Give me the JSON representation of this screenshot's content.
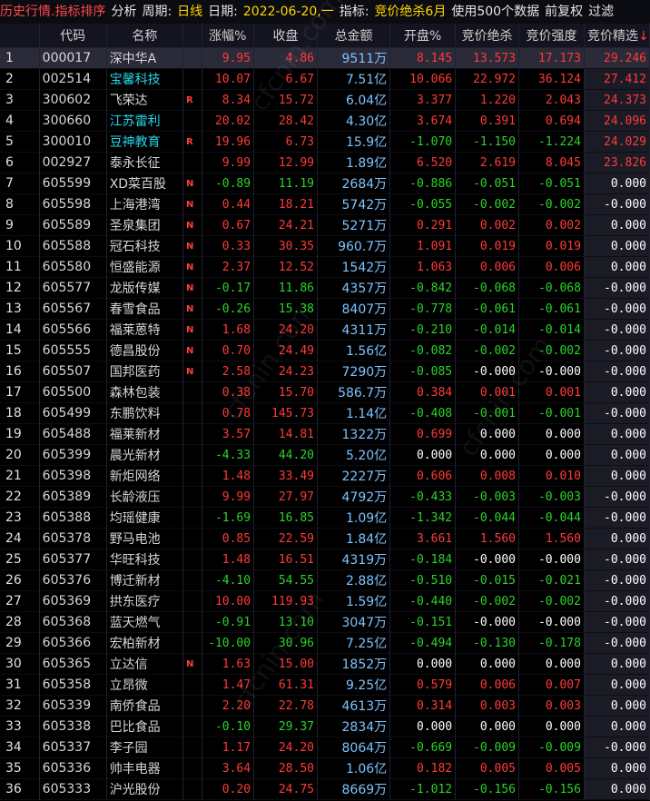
{
  "toolbar": {
    "items": [
      {
        "text": "历史行情.指标排序",
        "style": "t-red"
      },
      {
        "text": "分析",
        "style": "t-white"
      },
      {
        "text": "周期:",
        "style": "t-white"
      },
      {
        "text": "日线",
        "style": "t-yellow"
      },
      {
        "text": "日期:",
        "style": "t-white"
      },
      {
        "text": "2022-06-20,一",
        "style": "t-yellow"
      },
      {
        "text": "指标:",
        "style": "t-white"
      },
      {
        "text": "竞价绝杀6月",
        "style": "t-yellow"
      },
      {
        "text": "使用500个数据",
        "style": "t-white"
      },
      {
        "text": "前复权",
        "style": "t-white"
      },
      {
        "text": "过滤",
        "style": "t-white"
      }
    ]
  },
  "columns": [
    "",
    "代码",
    "名称",
    "",
    "涨幅%",
    "收盘",
    "总金额",
    "开盘%",
    "竞价绝杀",
    "竞价强度",
    "竞价精选"
  ],
  "sort_indicator": "↓",
  "watermark": "cfcnin.com",
  "rows": [
    {
      "i": "1",
      "code": "000017",
      "name": "深中华A",
      "cyan": false,
      "flag": "",
      "pct": "9.95",
      "close": "4.86",
      "amt": "9511万",
      "open": "8.145",
      "jj": "13.573",
      "qd": "17.173",
      "jx": "29.246",
      "sel": true
    },
    {
      "i": "2",
      "code": "002514",
      "name": "宝馨科技",
      "cyan": true,
      "flag": "",
      "pct": "10.07",
      "close": "6.67",
      "amt": "7.51亿",
      "open": "10.066",
      "jj": "22.972",
      "qd": "36.124",
      "jx": "27.412"
    },
    {
      "i": "3",
      "code": "300602",
      "name": "飞荣达",
      "cyan": false,
      "flag": "R",
      "pct": "8.34",
      "close": "15.72",
      "amt": "6.04亿",
      "open": "3.377",
      "jj": "1.220",
      "qd": "2.043",
      "jx": "24.373"
    },
    {
      "i": "4",
      "code": "300660",
      "name": "江苏雷利",
      "cyan": true,
      "flag": "",
      "pct": "20.02",
      "close": "28.42",
      "amt": "4.30亿",
      "open": "3.674",
      "jj": "0.391",
      "qd": "0.694",
      "jx": "24.096"
    },
    {
      "i": "5",
      "code": "300010",
      "name": "豆神教育",
      "cyan": true,
      "flag": "R",
      "pct": "19.96",
      "close": "6.73",
      "amt": "15.9亿",
      "open": "-1.070",
      "jj": "-1.150",
      "qd": "-1.224",
      "jx": "24.029"
    },
    {
      "i": "6",
      "code": "002927",
      "name": "泰永长征",
      "cyan": false,
      "flag": "",
      "pct": "9.99",
      "close": "12.99",
      "amt": "1.89亿",
      "open": "6.520",
      "jj": "2.619",
      "qd": "8.045",
      "jx": "23.826"
    },
    {
      "i": "7",
      "code": "605599",
      "name": "XD菜百股",
      "cyan": false,
      "flag": "N",
      "pct": "-0.89",
      "close": "11.19",
      "amt": "2684万",
      "open": "-0.886",
      "jj": "-0.051",
      "qd": "-0.051",
      "jx": "0.000"
    },
    {
      "i": "8",
      "code": "605598",
      "name": "上海港湾",
      "cyan": false,
      "flag": "N",
      "pct": "0.44",
      "close": "18.21",
      "amt": "5742万",
      "open": "-0.055",
      "jj": "-0.002",
      "qd": "-0.002",
      "jx": "-0.000"
    },
    {
      "i": "9",
      "code": "605589",
      "name": "圣泉集团",
      "cyan": false,
      "flag": "N",
      "pct": "0.67",
      "close": "24.21",
      "amt": "5271万",
      "open": "0.291",
      "jj": "0.002",
      "qd": "0.002",
      "jx": "0.000"
    },
    {
      "i": "10",
      "code": "605588",
      "name": "冠石科技",
      "cyan": false,
      "flag": "N",
      "pct": "0.33",
      "close": "30.35",
      "amt": "960.7万",
      "open": "1.091",
      "jj": "0.019",
      "qd": "0.019",
      "jx": "0.000"
    },
    {
      "i": "11",
      "code": "605580",
      "name": "恒盛能源",
      "cyan": false,
      "flag": "N",
      "pct": "2.37",
      "close": "12.52",
      "amt": "1542万",
      "open": "1.063",
      "jj": "0.006",
      "qd": "0.006",
      "jx": "0.000"
    },
    {
      "i": "12",
      "code": "605577",
      "name": "龙版传媒",
      "cyan": false,
      "flag": "N",
      "pct": "-0.17",
      "close": "11.86",
      "amt": "4357万",
      "open": "-0.842",
      "jj": "-0.068",
      "qd": "-0.068",
      "jx": "-0.000"
    },
    {
      "i": "13",
      "code": "605567",
      "name": "春雪食品",
      "cyan": false,
      "flag": "N",
      "pct": "-0.26",
      "close": "15.38",
      "amt": "8407万",
      "open": "-0.778",
      "jj": "-0.061",
      "qd": "-0.061",
      "jx": "-0.000"
    },
    {
      "i": "14",
      "code": "605566",
      "name": "福莱蒽特",
      "cyan": false,
      "flag": "N",
      "pct": "1.68",
      "close": "24.20",
      "amt": "4311万",
      "open": "-0.210",
      "jj": "-0.014",
      "qd": "-0.014",
      "jx": "-0.000"
    },
    {
      "i": "15",
      "code": "605555",
      "name": "德昌股份",
      "cyan": false,
      "flag": "N",
      "pct": "0.70",
      "close": "24.49",
      "amt": "1.56亿",
      "open": "-0.082",
      "jj": "-0.002",
      "qd": "-0.002",
      "jx": "-0.000"
    },
    {
      "i": "16",
      "code": "605507",
      "name": "国邦医药",
      "cyan": false,
      "flag": "N",
      "pct": "2.58",
      "close": "24.23",
      "amt": "7290万",
      "open": "-0.085",
      "jj": "-0.000",
      "qd": "-0.000",
      "jx": "-0.000"
    },
    {
      "i": "17",
      "code": "605500",
      "name": "森林包装",
      "cyan": false,
      "flag": "",
      "pct": "0.38",
      "close": "15.70",
      "amt": "586.7万",
      "open": "0.384",
      "jj": "0.001",
      "qd": "0.001",
      "jx": "0.000"
    },
    {
      "i": "18",
      "code": "605499",
      "name": "东鹏饮料",
      "cyan": false,
      "flag": "",
      "pct": "0.78",
      "close": "145.73",
      "amt": "1.14亿",
      "open": "-0.408",
      "jj": "-0.001",
      "qd": "-0.001",
      "jx": "-0.000"
    },
    {
      "i": "19",
      "code": "605488",
      "name": "福莱新材",
      "cyan": false,
      "flag": "",
      "pct": "3.57",
      "close": "14.81",
      "amt": "1322万",
      "open": "0.699",
      "jj": "0.000",
      "qd": "0.000",
      "jx": "0.000"
    },
    {
      "i": "20",
      "code": "605399",
      "name": "晨光新材",
      "cyan": false,
      "flag": "",
      "pct": "-4.33",
      "close": "44.20",
      "amt": "5.20亿",
      "open": "0.000",
      "jj": "0.000",
      "qd": "0.000",
      "jx": "0.000"
    },
    {
      "i": "21",
      "code": "605398",
      "name": "新炬网络",
      "cyan": false,
      "flag": "",
      "pct": "1.48",
      "close": "33.49",
      "amt": "2227万",
      "open": "0.606",
      "jj": "0.008",
      "qd": "0.010",
      "jx": "0.000"
    },
    {
      "i": "22",
      "code": "605389",
      "name": "长龄液压",
      "cyan": false,
      "flag": "",
      "pct": "9.99",
      "close": "27.97",
      "amt": "4792万",
      "open": "-0.433",
      "jj": "-0.003",
      "qd": "-0.003",
      "jx": "-0.000"
    },
    {
      "i": "23",
      "code": "605388",
      "name": "均瑶健康",
      "cyan": false,
      "flag": "",
      "pct": "-1.69",
      "close": "16.85",
      "amt": "1.09亿",
      "open": "-1.342",
      "jj": "-0.044",
      "qd": "-0.044",
      "jx": "-0.000"
    },
    {
      "i": "24",
      "code": "605378",
      "name": "野马电池",
      "cyan": false,
      "flag": "",
      "pct": "0.85",
      "close": "22.59",
      "amt": "1.84亿",
      "open": "3.661",
      "jj": "1.560",
      "qd": "1.560",
      "jx": "0.000"
    },
    {
      "i": "25",
      "code": "605377",
      "name": "华旺科技",
      "cyan": false,
      "flag": "",
      "pct": "1.48",
      "close": "16.51",
      "amt": "4319万",
      "open": "-0.184",
      "jj": "-0.000",
      "qd": "-0.000",
      "jx": "-0.000"
    },
    {
      "i": "26",
      "code": "605376",
      "name": "博迁新材",
      "cyan": false,
      "flag": "",
      "pct": "-4.10",
      "close": "54.55",
      "amt": "2.88亿",
      "open": "-0.510",
      "jj": "-0.015",
      "qd": "-0.021",
      "jx": "-0.000"
    },
    {
      "i": "27",
      "code": "605369",
      "name": "拱东医疗",
      "cyan": false,
      "flag": "",
      "pct": "10.00",
      "close": "119.93",
      "amt": "1.59亿",
      "open": "-0.440",
      "jj": "-0.002",
      "qd": "-0.002",
      "jx": "-0.000"
    },
    {
      "i": "28",
      "code": "605368",
      "name": "蓝天燃气",
      "cyan": false,
      "flag": "",
      "pct": "-0.91",
      "close": "13.10",
      "amt": "3047万",
      "open": "-0.151",
      "jj": "-0.000",
      "qd": "-0.000",
      "jx": "-0.000"
    },
    {
      "i": "29",
      "code": "605366",
      "name": "宏柏新材",
      "cyan": false,
      "flag": "",
      "pct": "-10.00",
      "close": "30.96",
      "amt": "7.25亿",
      "open": "-0.494",
      "jj": "-0.130",
      "qd": "-0.178",
      "jx": "-0.000"
    },
    {
      "i": "30",
      "code": "605365",
      "name": "立达信",
      "cyan": false,
      "flag": "N",
      "pct": "1.63",
      "close": "15.00",
      "amt": "1852万",
      "open": "0.000",
      "jj": "0.000",
      "qd": "0.000",
      "jx": "0.000"
    },
    {
      "i": "31",
      "code": "605358",
      "name": "立昂微",
      "cyan": false,
      "flag": "",
      "pct": "1.47",
      "close": "61.31",
      "amt": "9.25亿",
      "open": "0.579",
      "jj": "0.006",
      "qd": "0.007",
      "jx": "0.000"
    },
    {
      "i": "32",
      "code": "605339",
      "name": "南侨食品",
      "cyan": false,
      "flag": "",
      "pct": "2.20",
      "close": "22.78",
      "amt": "4613万",
      "open": "0.314",
      "jj": "0.003",
      "qd": "0.003",
      "jx": "0.000"
    },
    {
      "i": "33",
      "code": "605338",
      "name": "巴比食品",
      "cyan": false,
      "flag": "",
      "pct": "-0.10",
      "close": "29.37",
      "amt": "2834万",
      "open": "0.000",
      "jj": "0.000",
      "qd": "0.000",
      "jx": "0.000"
    },
    {
      "i": "34",
      "code": "605337",
      "name": "李子园",
      "cyan": false,
      "flag": "",
      "pct": "1.17",
      "close": "24.20",
      "amt": "8064万",
      "open": "-0.669",
      "jj": "-0.009",
      "qd": "-0.009",
      "jx": "-0.000"
    },
    {
      "i": "35",
      "code": "605336",
      "name": "帅丰电器",
      "cyan": false,
      "flag": "",
      "pct": "3.64",
      "close": "28.50",
      "amt": "1.06亿",
      "open": "0.182",
      "jj": "0.005",
      "qd": "0.005",
      "jx": "0.000"
    },
    {
      "i": "36",
      "code": "605333",
      "name": "沪光股份",
      "cyan": false,
      "flag": "",
      "pct": "0.20",
      "close": "24.75",
      "amt": "8669万",
      "open": "-1.012",
      "jj": "-0.156",
      "qd": "-0.156",
      "jx": "0.000"
    }
  ]
}
